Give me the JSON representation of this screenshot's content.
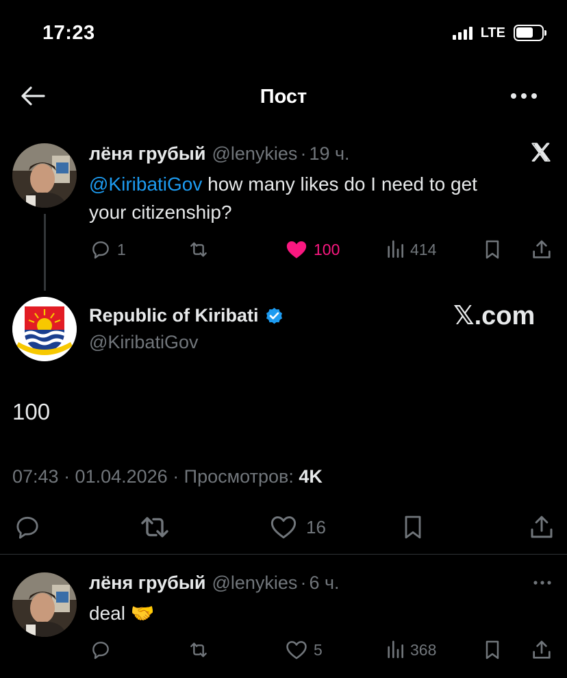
{
  "status_bar": {
    "time": "17:23",
    "network": "LTE",
    "battery_level": 0.6
  },
  "nav": {
    "title": "Пост",
    "back_icon": "arrow-left-icon",
    "more_icon": "more-horizontal-icon"
  },
  "quoted_tweet": {
    "name": "лёня грубый",
    "handle": "@lenykies",
    "time": "19 ч.",
    "mention": "@KiribatiGov",
    "text_line1": " how many likes do I need to get",
    "text_line2": "your citizenship?",
    "replies": "1",
    "likes": "100",
    "views": "414"
  },
  "main_tweet": {
    "name": "Republic of Kiribati",
    "handle": "@KiribatiGov",
    "watermark": "𝕏.com",
    "text": "100",
    "timestamp": "07:43 · 01.04.2026 · Просмотров: ",
    "views": "4K",
    "likes": "16"
  },
  "reply_tweet": {
    "name": "лёня грубый",
    "handle": "@lenykies",
    "time": "6 ч.",
    "text": "deal 🤝",
    "likes": "5",
    "views": "368"
  },
  "colors": {
    "accent": "#1d9bf0",
    "like": "#f91880",
    "muted": "#71767b",
    "verified": "#1d9bf0"
  }
}
